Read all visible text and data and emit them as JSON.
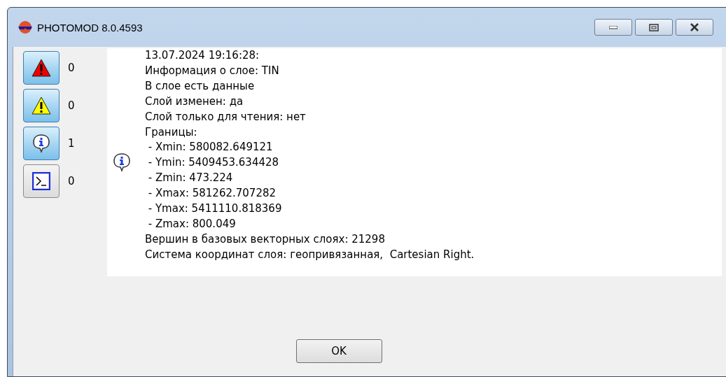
{
  "window": {
    "title": "PHOTOMOD 8.0.4593"
  },
  "filters": [
    {
      "kind": "error",
      "selected": true,
      "count": "0"
    },
    {
      "kind": "warning",
      "selected": true,
      "count": "0"
    },
    {
      "kind": "info",
      "selected": true,
      "count": "1"
    },
    {
      "kind": "console",
      "selected": false,
      "count": "0"
    }
  ],
  "messages": [
    {
      "kind": "info",
      "lines": [
        "13.07.2024 19:16:28:",
        "Информация о слое: TIN",
        "В слое есть данные",
        "Слой изменен: да",
        "Слой только для чтения: нет",
        "Границы:",
        " - Xmin: 580082.649121",
        " - Ymin: 5409453.634428",
        " - Zmin: 473.224",
        " - Xmax: 581262.707282",
        " - Ymax: 5411110.818369",
        " - Zmax: 800.049",
        "Вершин в базовых векторных слоях: 21298",
        "Система координат слоя: геопривязанная,  Cartesian Right."
      ]
    }
  ],
  "buttons": [
    "OK"
  ]
}
